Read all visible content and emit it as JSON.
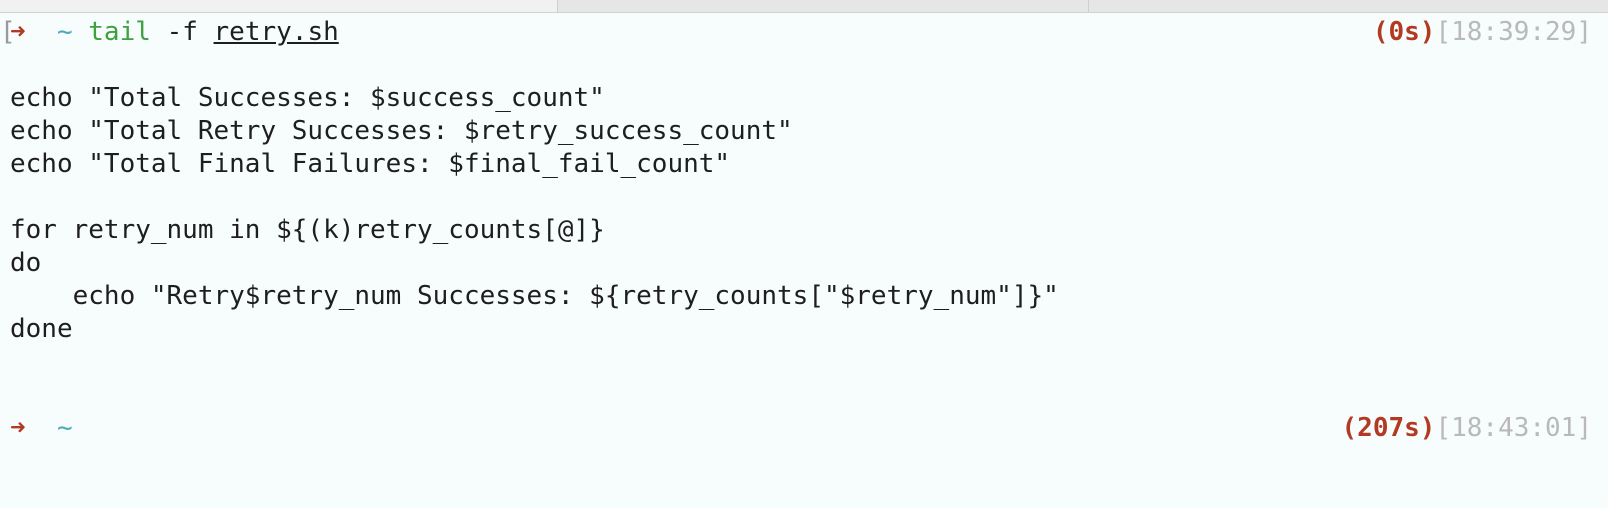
{
  "colors": {
    "background": "#f7fcfc",
    "prompt_arrow": "#b23a22",
    "prompt_tilde": "#4ea9bd",
    "command": "#3fa03f",
    "elapsed": "#b23a22",
    "clock": "#b9b9b9"
  },
  "prompt1": {
    "bracket": "[",
    "arrow": "➜",
    "dir": "~",
    "command": "tail",
    "flag": "-f",
    "file": "retry.sh",
    "elapsed": "(0s)",
    "clock": "[18:39:29]"
  },
  "output": [
    "echo \"Total Successes: $success_count\"",
    "echo \"Total Retry Successes: $retry_success_count\"",
    "echo \"Total Final Failures: $final_fail_count\"",
    "for retry_num in ${(k)retry_counts[@]}",
    "do",
    "    echo \"Retry$retry_num Successes: ${retry_counts[\"$retry_num\"]}\"",
    "done"
  ],
  "prompt2": {
    "arrow": "➜",
    "dir": "~",
    "elapsed": "(207s)",
    "clock": "[18:43:01]"
  }
}
